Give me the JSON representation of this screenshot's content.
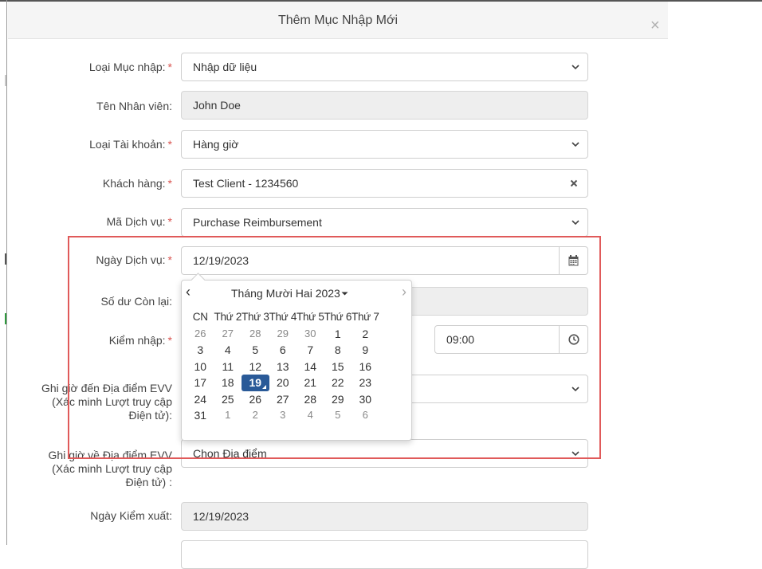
{
  "modal": {
    "title": "Thêm Mục Nhập Mới",
    "close_label": "×"
  },
  "required_mark": "*",
  "form": {
    "entry_type": {
      "label": "Loại Mục nhập:",
      "value": "Nhập dữ liệu"
    },
    "employee_name": {
      "label": "Tên Nhân viên:",
      "value": "John Doe"
    },
    "account_type": {
      "label": "Loại Tài khoản:",
      "value": "Hàng giờ"
    },
    "client": {
      "label": "Khách hàng:",
      "value": "Test Client - 1234560"
    },
    "service_code": {
      "label": "Mã Dịch vụ:",
      "value": "Purchase Reimbursement"
    },
    "service_date": {
      "label": "Ngày Dịch vụ:",
      "value": "12/19/2023"
    },
    "remaining_balance": {
      "label": "Số dư Còn lại:"
    },
    "check_in": {
      "label": "Kiểm nhập:",
      "time": "09:00"
    },
    "evv_arrival": {
      "label_lines": [
        "Ghi giờ đến Địa điểm EVV",
        "(Xác minh Lượt truy cập",
        "Điện tử):"
      ]
    },
    "evv_departure": {
      "label_lines": [
        "Ghi giờ về Địa điểm EVV",
        "(Xác minh Lượt truy cập",
        "Điện tử) :"
      ],
      "placeholder": "Chọn Địa điểm"
    },
    "check_out_date": {
      "label": "Ngày Kiểm xuất:",
      "value": "12/19/2023"
    }
  },
  "datepicker": {
    "prev": "‹",
    "next": "›",
    "month_title": "Tháng Mười Hai 2023",
    "weekdays": [
      "CN",
      "Thứ 2",
      "Thứ 3",
      "Thứ 4",
      "Thứ 5",
      "Thứ 6",
      "Thứ 7"
    ],
    "weeks": [
      [
        "26",
        "27",
        "28",
        "29",
        "30",
        "1",
        "2"
      ],
      [
        "3",
        "4",
        "5",
        "6",
        "7",
        "8",
        "9"
      ],
      [
        "10",
        "11",
        "12",
        "13",
        "14",
        "15",
        "16"
      ],
      [
        "17",
        "18",
        "19",
        "20",
        "21",
        "22",
        "23"
      ],
      [
        "24",
        "25",
        "26",
        "27",
        "28",
        "29",
        "30"
      ],
      [
        "31",
        "1",
        "2",
        "3",
        "4",
        "5",
        "6"
      ]
    ],
    "selected_day": "19"
  },
  "colors": {
    "accent": "#2a5a98",
    "required": "#d9534f",
    "highlight_border": "#e05a5a"
  }
}
